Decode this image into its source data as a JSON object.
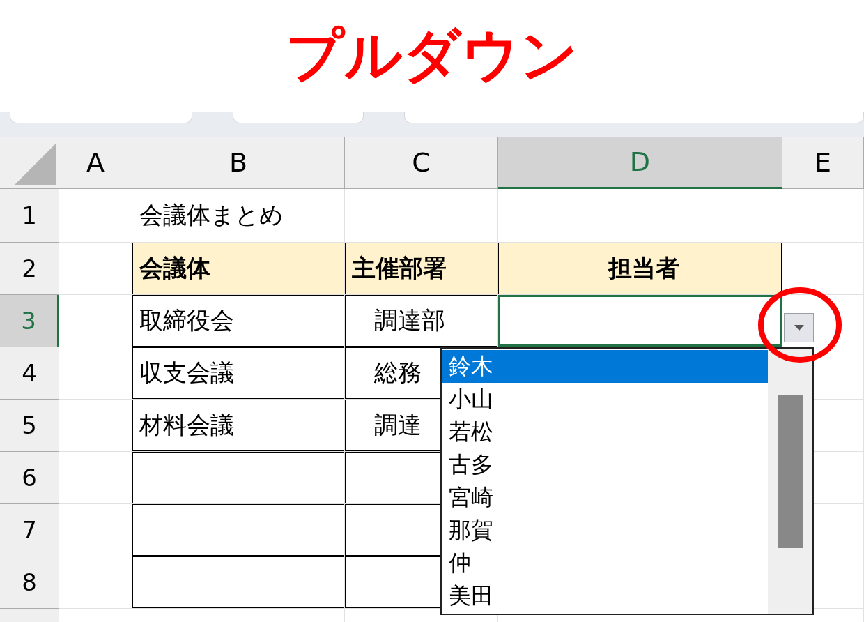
{
  "title": "プルダウン",
  "columns": [
    {
      "label": "A",
      "selected": false
    },
    {
      "label": "B",
      "selected": false
    },
    {
      "label": "C",
      "selected": false
    },
    {
      "label": "D",
      "selected": true
    },
    {
      "label": "E",
      "selected": false
    }
  ],
  "rows": [
    {
      "label": "1",
      "selected": false,
      "cells": [
        {
          "text": "",
          "kind": "plain"
        },
        {
          "text": "会議体まとめ",
          "kind": "plain"
        },
        {
          "text": "",
          "kind": "plain"
        },
        {
          "text": "",
          "kind": "plain"
        }
      ]
    },
    {
      "label": "2",
      "selected": false,
      "cells": [
        {
          "text": "",
          "kind": "plain"
        },
        {
          "text": "会議体",
          "kind": "header"
        },
        {
          "text": "主催部署",
          "kind": "header"
        },
        {
          "text": "担当者",
          "kind": "header"
        }
      ]
    },
    {
      "label": "3",
      "selected": true,
      "cells": [
        {
          "text": "",
          "kind": "plain"
        },
        {
          "text": "取締役会",
          "kind": "table"
        },
        {
          "text": "調達部",
          "kind": "table"
        },
        {
          "text": "",
          "kind": "active"
        }
      ]
    },
    {
      "label": "4",
      "selected": false,
      "cells": [
        {
          "text": "",
          "kind": "plain"
        },
        {
          "text": "収支会議",
          "kind": "table"
        },
        {
          "text": "総務",
          "kind": "table"
        },
        {
          "text": "",
          "kind": "plain"
        }
      ]
    },
    {
      "label": "5",
      "selected": false,
      "cells": [
        {
          "text": "",
          "kind": "plain"
        },
        {
          "text": "材料会議",
          "kind": "table"
        },
        {
          "text": "調達",
          "kind": "table"
        },
        {
          "text": "",
          "kind": "plain"
        }
      ]
    },
    {
      "label": "6",
      "selected": false,
      "cells": [
        {
          "text": "",
          "kind": "plain"
        },
        {
          "text": "",
          "kind": "table"
        },
        {
          "text": "",
          "kind": "table"
        },
        {
          "text": "",
          "kind": "plain"
        }
      ]
    },
    {
      "label": "7",
      "selected": false,
      "cells": [
        {
          "text": "",
          "kind": "plain"
        },
        {
          "text": "",
          "kind": "table"
        },
        {
          "text": "",
          "kind": "table"
        },
        {
          "text": "",
          "kind": "plain"
        }
      ]
    },
    {
      "label": "8",
      "selected": false,
      "cells": [
        {
          "text": "",
          "kind": "plain"
        },
        {
          "text": "",
          "kind": "table"
        },
        {
          "text": "",
          "kind": "table"
        },
        {
          "text": "",
          "kind": "plain"
        }
      ]
    }
  ],
  "dropdown": {
    "items": [
      {
        "label": "鈴木",
        "selected": true
      },
      {
        "label": "小山",
        "selected": false
      },
      {
        "label": "若松",
        "selected": false
      },
      {
        "label": "古多",
        "selected": false
      },
      {
        "label": "宮崎",
        "selected": false
      },
      {
        "label": "那賀",
        "selected": false
      },
      {
        "label": "仲",
        "selected": false
      },
      {
        "label": "美田",
        "selected": false
      }
    ]
  }
}
